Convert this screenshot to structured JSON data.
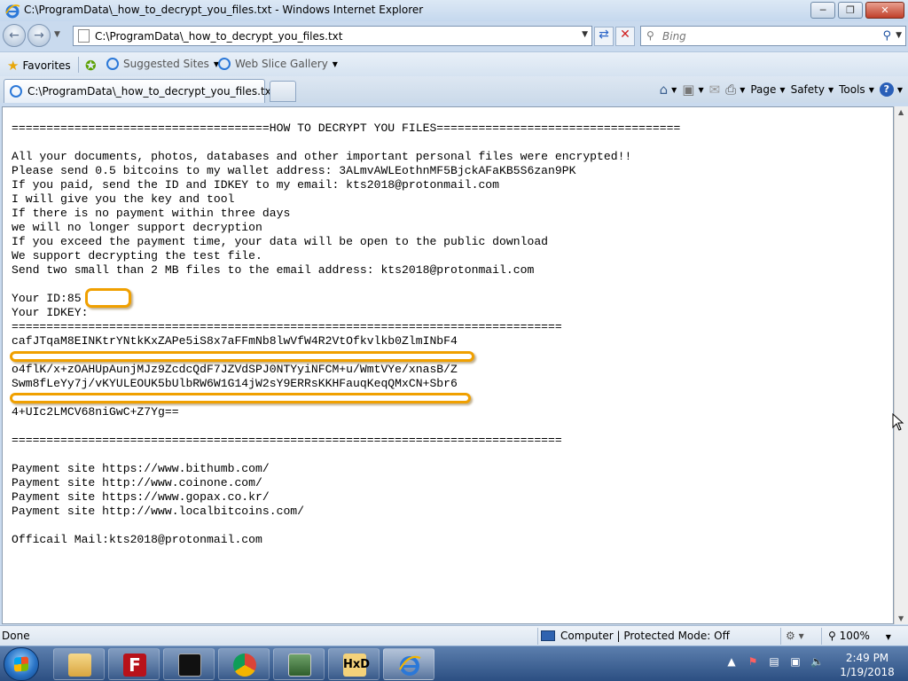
{
  "window": {
    "title": "C:\\ProgramData\\_how_to_decrypt_you_files.txt - Windows Internet Explorer"
  },
  "address": {
    "url": "C:\\ProgramData\\_how_to_decrypt_you_files.txt"
  },
  "search": {
    "placeholder": "Bing"
  },
  "favorites": {
    "favorites_label": "Favorites",
    "suggested_label": "Suggested Sites",
    "webslice_label": "Web Slice Gallery"
  },
  "tab": {
    "label": "C:\\ProgramData\\_how_to_decrypt_you_files.txt"
  },
  "commandbar": {
    "page_label": "Page",
    "safety_label": "Safety",
    "tools_label": "Tools"
  },
  "document": {
    "lines": [
      "=====================================HOW TO DECRYPT YOU FILES===================================",
      "",
      "All your documents, photos, databases and other important personal files were encrypted!!",
      "Please send 0.5 bitcoins to my wallet address: 3ALmvAWLEothnMF5BjckAFaKB5S6zan9PK",
      "If you paid, send the ID and IDKEY to my email: kts2018@protonmail.com",
      "I will give you the key and tool",
      "If there is no payment within three days",
      "we will no longer support decryption",
      "If you exceed the payment time, your data will be open to the public download",
      "We support decrypting the test file.",
      "Send two small than 2 MB files to the email address: kts2018@protonmail.com",
      "",
      "Your ID:85",
      "Your IDKEY:",
      "===============================================================================",
      "cafJTqaM8EINKtrYNtkKxZAPe5iS8x7aFFmNb8lwVfW4R2VtOfkvlkb0ZlmINbF4",
      "",
      "o4flK/x+zOAHUpAunjMJz9ZcdcQdF7JZVdSPJ0NTYyiNFCM+u/WmtVYe/xnasB/Z",
      "Swm8fLeYy7j/vKYULEOUK5bUlbRW6W1G14jW2sY9ERRsKKHFauqKeqQMxCN+Sbr6",
      "",
      "4+UIc2LMCV68niGwC+Z7Yg==",
      "",
      "===============================================================================",
      "",
      "Payment site https://www.bithumb.com/",
      "Payment site http://www.coinone.com/",
      "Payment site https://www.gopax.co.kr/",
      "Payment site http://www.localbitcoins.com/",
      "",
      "Officail Mail:kts2018@protonmail.com"
    ]
  },
  "statusbar": {
    "status_text": "Done",
    "zone_text": "Computer | Protected Mode: Off",
    "zoom_text": "100%"
  },
  "taskbar": {
    "time": "2:49 PM",
    "date": "1/19/2018"
  },
  "colors": {
    "redaction_outline": "#f0a000",
    "taskbar": "#2c4f82"
  }
}
